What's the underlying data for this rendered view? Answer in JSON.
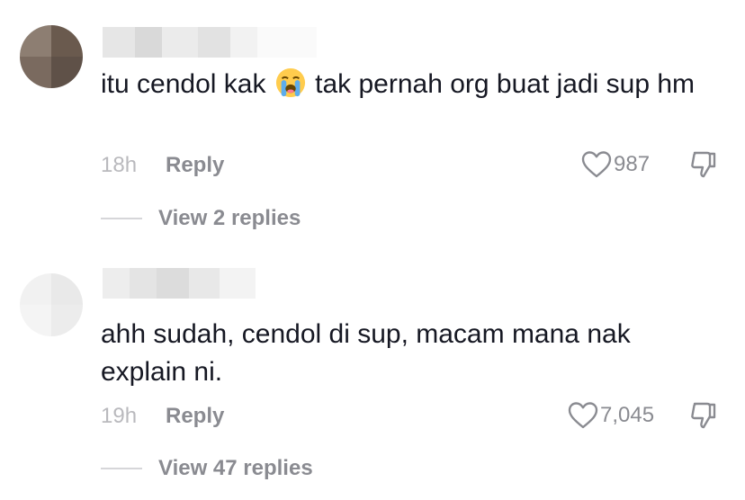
{
  "comments": [
    {
      "text_before": "itu cendol kak ",
      "emoji": "loudly-crying-face",
      "text_after": " tak pernah org buat jadi sup hm",
      "time": "18h",
      "reply_label": "Reply",
      "likes": "987",
      "view_replies": "View 2 replies"
    },
    {
      "text": "ahh sudah, cendol di sup, macam mana nak explain ni.",
      "time": "19h",
      "reply_label": "Reply",
      "likes": "7,045",
      "view_replies": "View 47 replies"
    }
  ],
  "icons": {
    "like": "heart-outline-icon",
    "dislike": "thumbs-down-outline-icon"
  },
  "colors": {
    "text": "#161823",
    "muted": "#8a8b91",
    "time": "#b9b9bd"
  }
}
